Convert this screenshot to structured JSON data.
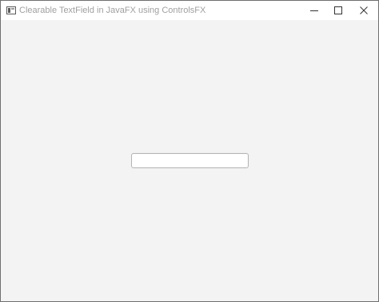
{
  "window": {
    "title": "Clearable TextField in JavaFX using ControlsFX",
    "icon": "java-app-icon",
    "controls": {
      "minimize_icon": "minimize-icon",
      "maximize_icon": "maximize-icon",
      "close_icon": "close-icon"
    }
  },
  "content": {
    "text_field": {
      "value": "",
      "placeholder": ""
    }
  }
}
